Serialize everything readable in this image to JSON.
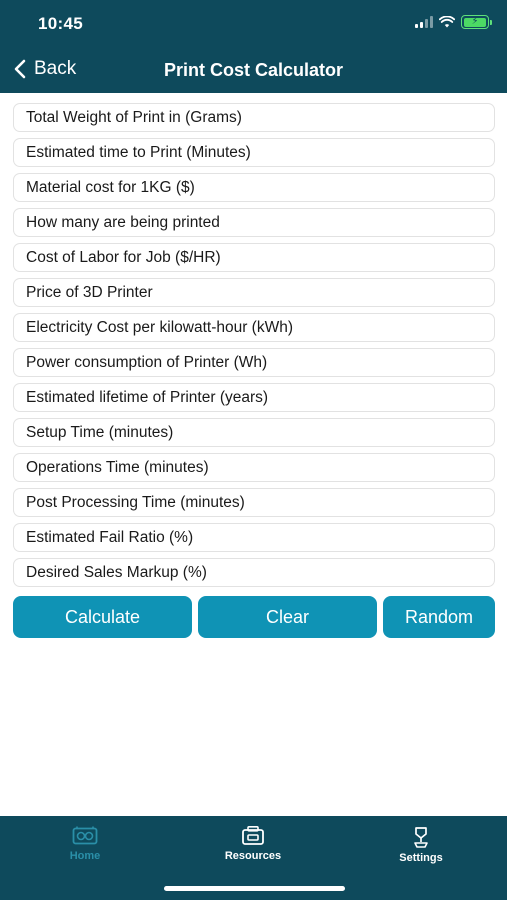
{
  "status_bar": {
    "time": "10:45"
  },
  "nav": {
    "back_label": "Back",
    "title": "Print Cost Calculator"
  },
  "fields": [
    {
      "placeholder": "Total Weight of Print in (Grams)",
      "value": ""
    },
    {
      "placeholder": "Estimated time to Print (Minutes)",
      "value": ""
    },
    {
      "placeholder": "Material cost for 1KG ($)",
      "value": ""
    },
    {
      "placeholder": "How many are being printed",
      "value": ""
    },
    {
      "placeholder": "Cost of Labor for Job ($/HR)",
      "value": ""
    },
    {
      "placeholder": "Price of 3D Printer",
      "value": ""
    },
    {
      "placeholder": "Electricity Cost per kilowatt-hour (kWh)",
      "value": ""
    },
    {
      "placeholder": "Power consumption of Printer (Wh)",
      "value": ""
    },
    {
      "placeholder": "Estimated lifetime of Printer (years)",
      "value": ""
    },
    {
      "placeholder": "Setup Time (minutes)",
      "value": ""
    },
    {
      "placeholder": "Operations Time (minutes)",
      "value": ""
    },
    {
      "placeholder": "Post Processing Time (minutes)",
      "value": ""
    },
    {
      "placeholder": "Estimated Fail Ratio (%)",
      "value": ""
    },
    {
      "placeholder": "Desired Sales Markup (%)",
      "value": ""
    }
  ],
  "actions": {
    "calculate": "Calculate",
    "clear": "Clear",
    "random": "Random"
  },
  "tabs": [
    {
      "label": "Home",
      "icon": "home-icon",
      "active": true
    },
    {
      "label": "Resources",
      "icon": "resources-icon",
      "active": false
    },
    {
      "label": "Settings",
      "icon": "settings-icon",
      "active": false
    }
  ],
  "colors": {
    "header_bg": "#0e4a5c",
    "button_bg": "#0f93b5",
    "active_tab": "#2a8fa8",
    "battery": "#4cd964"
  }
}
